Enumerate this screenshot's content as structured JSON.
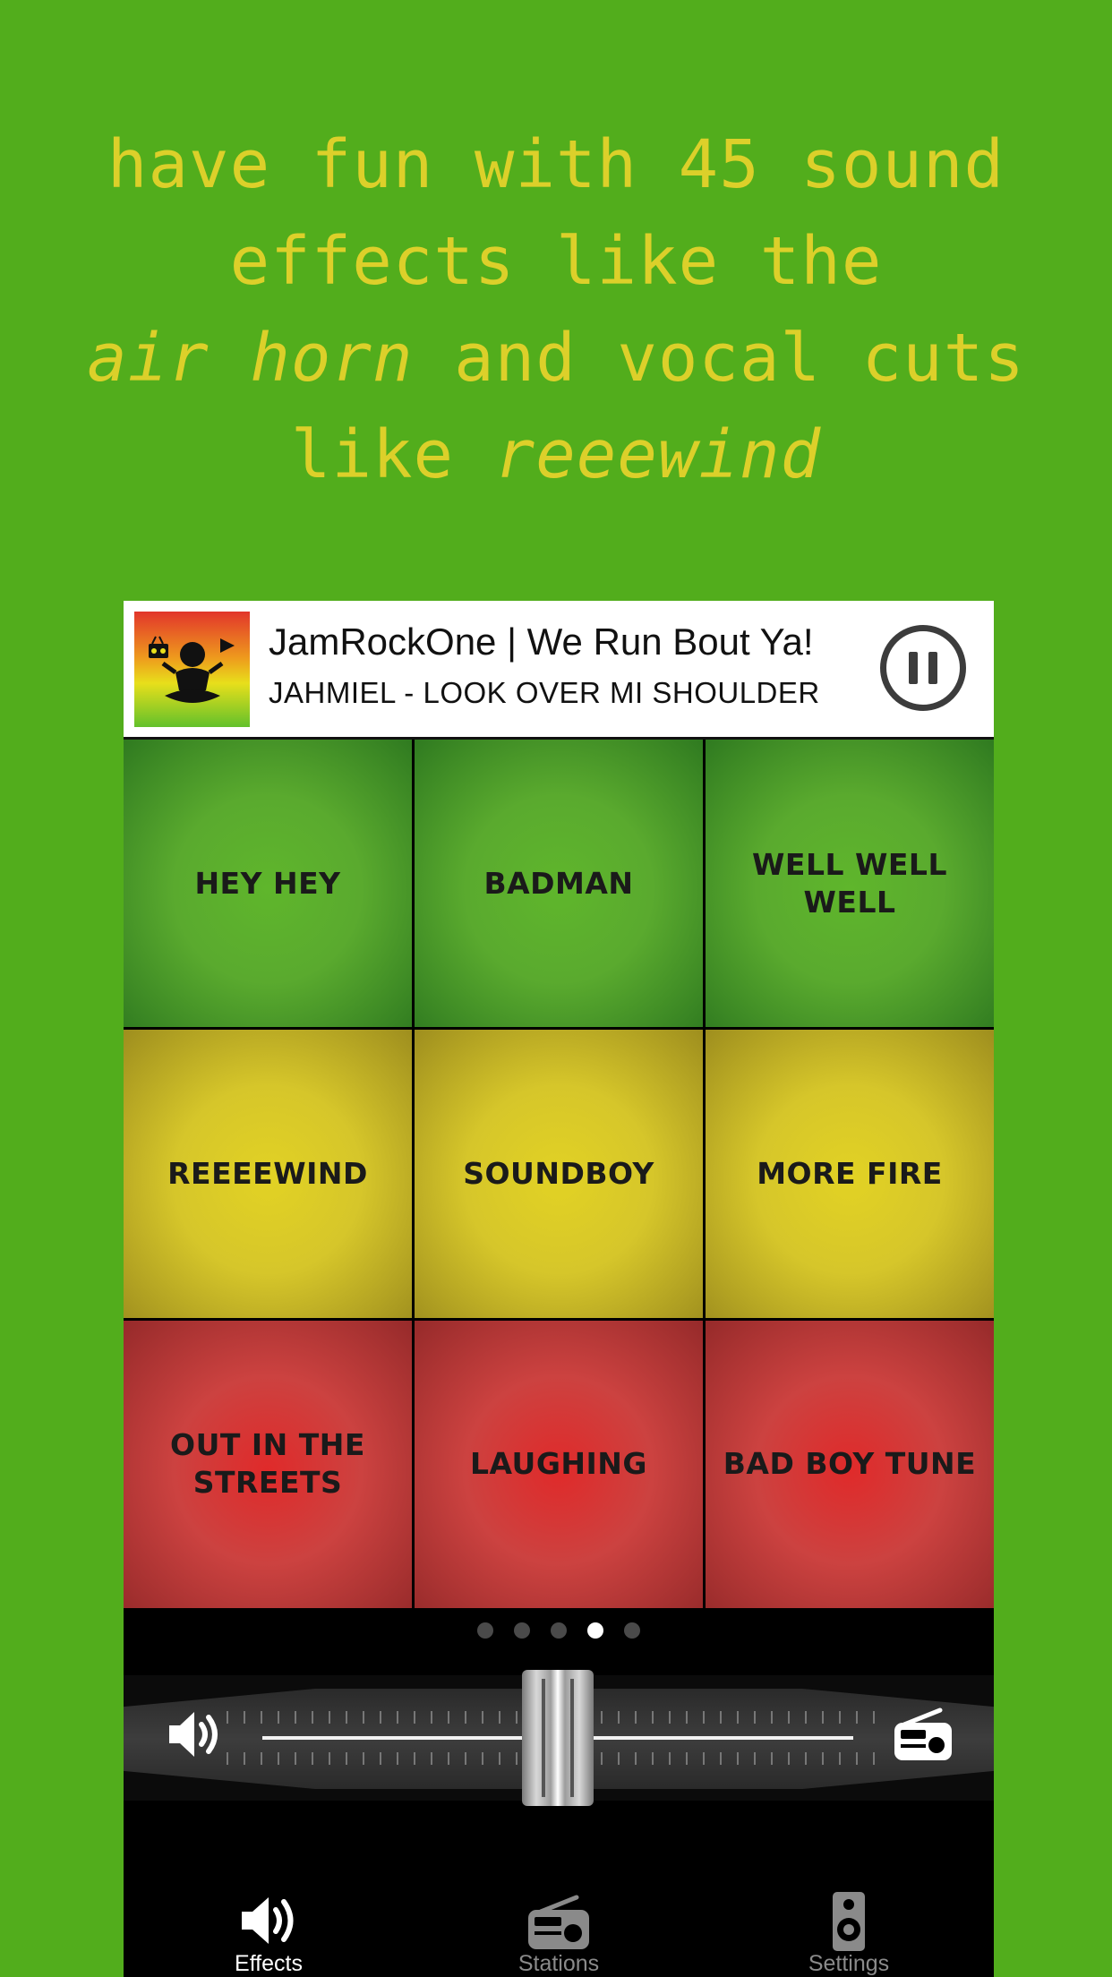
{
  "headline": {
    "line1": "have fun with 45 sound",
    "line2": "effects like the",
    "line3_em": "air horn",
    "line3_rest": " and vocal cuts",
    "line4_start": "like ",
    "line4_em": "reeewind"
  },
  "player": {
    "station": "JamRockOne | We Run Bout Ya!",
    "track": "JAHMIEL - LOOK OVER MI SHOULDER",
    "state": "playing",
    "artwork_icon": "meditating-figure-radio-logo"
  },
  "pads": [
    {
      "label": "HEY HEY",
      "color": "green"
    },
    {
      "label": "BADMAN",
      "color": "green"
    },
    {
      "label": "WELL WELL WELL",
      "color": "green"
    },
    {
      "label": "REEEEWIND",
      "color": "yellow"
    },
    {
      "label": "SOUNDBOY",
      "color": "yellow"
    },
    {
      "label": "MORE FIRE",
      "color": "yellow"
    },
    {
      "label": "OUT IN THE STREETS",
      "color": "red"
    },
    {
      "label": "LAUGHING",
      "color": "red"
    },
    {
      "label": "BAD BOY TUNE",
      "color": "red"
    }
  ],
  "pager": {
    "count": 5,
    "active_index": 3
  },
  "mixer": {
    "left_icon": "speaker-volume-icon",
    "right_icon": "radio-icon",
    "crossfade_position": 0.5
  },
  "tabs": [
    {
      "label": "Effects",
      "icon": "speaker-volume-icon",
      "active": true
    },
    {
      "label": "Stations",
      "icon": "radio-icon",
      "active": false
    },
    {
      "label": "Settings",
      "icon": "loudspeaker-icon",
      "active": false
    }
  ],
  "colors": {
    "background": "#52ad1c",
    "headline": "#dcd02a",
    "pad_green": "#5aaa2e",
    "pad_yellow": "#d6c62a",
    "pad_red": "#cc4240"
  }
}
